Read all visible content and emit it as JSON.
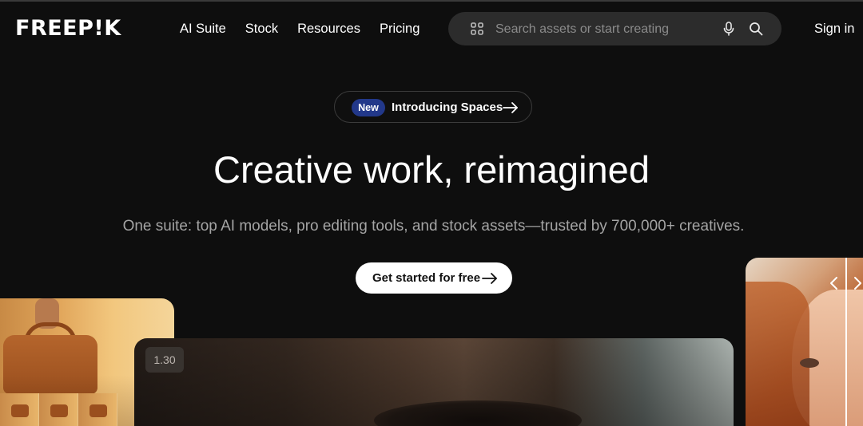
{
  "header": {
    "logo_text": "FREEP!K",
    "nav": [
      "AI Suite",
      "Stock",
      "Resources",
      "Pricing"
    ],
    "search_placeholder": "Search assets or start creating",
    "signin_label": "Sign in"
  },
  "hero": {
    "badge": "New",
    "announcement": "Introducing Spaces",
    "headline": "Creative work, reimagined",
    "subheadline": "One suite: top AI models, pro editing tools, and stock assets—trusted by 700,000+ creatives.",
    "cta_label": "Get started for free"
  },
  "media": {
    "video_timestamp": "1.30"
  },
  "colors": {
    "background": "#0e0e0e",
    "badge_bg": "#22388a",
    "search_bg": "#2c2c2c",
    "cta_bg": "#ffffff"
  },
  "icons": [
    "grid-icon",
    "microphone-icon",
    "search-icon",
    "arrow-right-icon",
    "chevron-left-icon",
    "chevron-right-icon"
  ]
}
